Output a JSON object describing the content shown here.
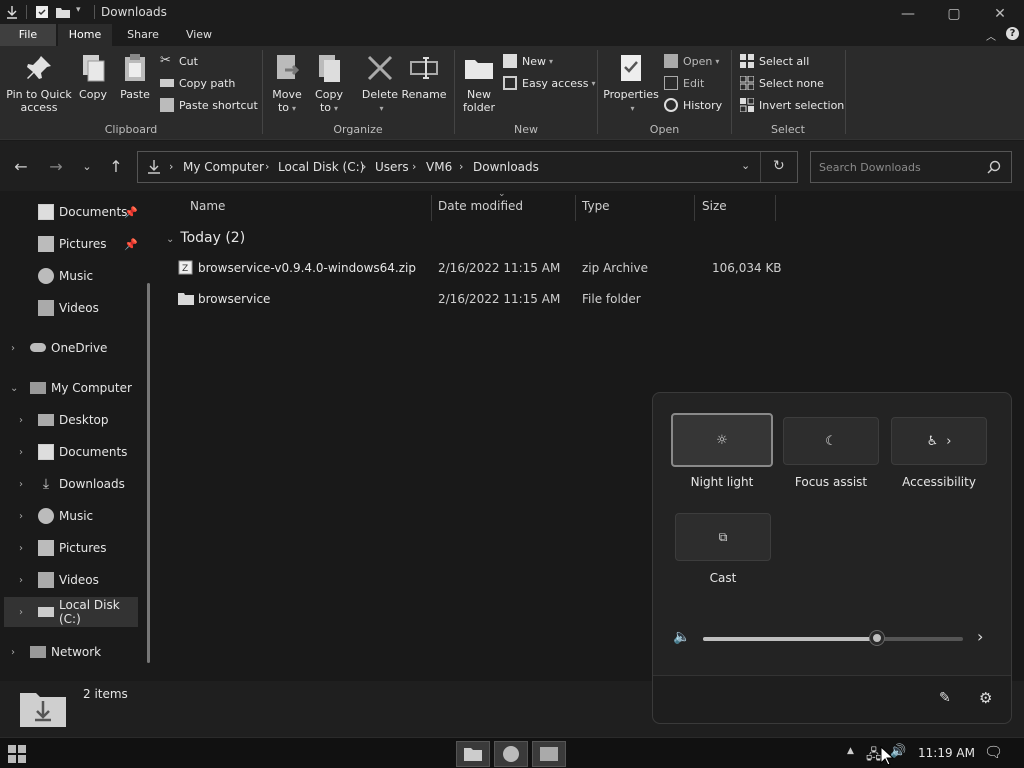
{
  "window": {
    "title": "Downloads",
    "controls": {
      "minimize": "—",
      "maximize": "▢",
      "close": "✕"
    }
  },
  "ribbon_tabs": {
    "file": "File",
    "home": "Home",
    "share": "Share",
    "view": "View"
  },
  "ribbon": {
    "clipboard": {
      "label": "Clipboard",
      "pin": "Pin to Quick access",
      "copy": "Copy",
      "paste": "Paste",
      "cut": "Cut",
      "copy_path": "Copy path",
      "paste_shortcut": "Paste shortcut"
    },
    "organize": {
      "label": "Organize",
      "move_to": "Move to",
      "copy_to": "Copy to",
      "delete": "Delete",
      "rename": "Rename"
    },
    "new": {
      "label": "New",
      "new_folder": "New folder",
      "new_item": "New",
      "easy_access": "Easy access"
    },
    "open": {
      "label": "Open",
      "properties": "Properties",
      "open": "Open",
      "edit": "Edit",
      "history": "History"
    },
    "select": {
      "label": "Select",
      "select_all": "Select all",
      "select_none": "Select none",
      "invert": "Invert selection"
    }
  },
  "address": {
    "crumbs": [
      "My Computer",
      "Local Disk (C:)",
      "Users",
      "VM6",
      "Downloads"
    ],
    "search_placeholder": "Search Downloads"
  },
  "sidebar": {
    "items": [
      {
        "label": "Documents",
        "icon": "documents-icon",
        "pinned": true
      },
      {
        "label": "Pictures",
        "icon": "pictures-icon",
        "pinned": true
      },
      {
        "label": "Music",
        "icon": "music-icon"
      },
      {
        "label": "Videos",
        "icon": "videos-icon"
      },
      {
        "label": "OneDrive",
        "icon": "cloud-icon"
      },
      {
        "label": "My Computer",
        "icon": "computer-icon"
      },
      {
        "label": "Desktop",
        "icon": "desktop-icon"
      },
      {
        "label": "Documents",
        "icon": "documents-icon"
      },
      {
        "label": "Downloads",
        "icon": "download-icon"
      },
      {
        "label": "Music",
        "icon": "music-icon"
      },
      {
        "label": "Pictures",
        "icon": "pictures-icon"
      },
      {
        "label": "Videos",
        "icon": "videos-icon"
      },
      {
        "label": "Local Disk (C:)",
        "icon": "drive-icon"
      },
      {
        "label": "Network",
        "icon": "network-icon"
      }
    ]
  },
  "filelist": {
    "columns": [
      "Name",
      "Date modified",
      "Type",
      "Size"
    ],
    "group": "Today (2)",
    "rows": [
      {
        "name": "browservice-v0.9.4.0-windows64.zip",
        "date": "2/16/2022 11:15 AM",
        "type": "zip Archive",
        "size": "106,034 KB",
        "icon": "zip-icon"
      },
      {
        "name": "browservice",
        "date": "2/16/2022 11:15 AM",
        "type": "File folder",
        "size": "",
        "icon": "folder-icon"
      }
    ]
  },
  "status": {
    "count": "2 items"
  },
  "quick_settings": {
    "tiles": [
      {
        "label": "Night light",
        "icon": "night-light-icon",
        "active": true
      },
      {
        "label": "Focus assist",
        "icon": "moon-icon",
        "active": false
      },
      {
        "label": "Accessibility",
        "icon": "accessibility-icon",
        "active": false
      },
      {
        "label": "Cast",
        "icon": "cast-icon",
        "active": false
      }
    ],
    "volume_level": 0.67
  },
  "taskbar": {
    "time": "11:19 AM"
  },
  "colors": {
    "accent_tab": "#3f3f3f",
    "ribbon_bg": "#2b2b2b",
    "window_bg": "#191919"
  }
}
